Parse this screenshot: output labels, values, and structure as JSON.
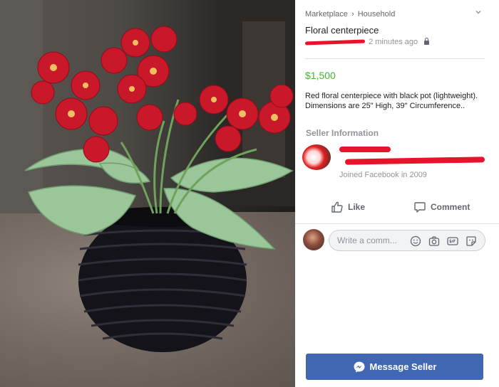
{
  "breadcrumb": {
    "parent": "Marketplace",
    "separator": "›",
    "current": "Household"
  },
  "listing": {
    "title": "Floral centerpiece",
    "posted": "2 minutes ago",
    "price": "$1,500",
    "description": "Red floral centerpiece with black pot (lightweight). Dimensions are 25\" High, 39\" Circumference.."
  },
  "seller": {
    "heading": "Seller Information",
    "joined": "Joined Facebook in 2009"
  },
  "actions": {
    "like": "Like",
    "comment": "Comment"
  },
  "comment_input": {
    "placeholder": "Write a comm..."
  },
  "message_button": {
    "label": "Message Seller"
  },
  "colors": {
    "accent": "#4267b2",
    "price": "#42b72a",
    "redaction": "#e8122a"
  },
  "icons": [
    "chevron-down-icon",
    "lock-icon",
    "like-icon",
    "comment-icon",
    "emoji-icon",
    "camera-icon",
    "gif-icon",
    "sticker-icon",
    "messenger-icon"
  ]
}
